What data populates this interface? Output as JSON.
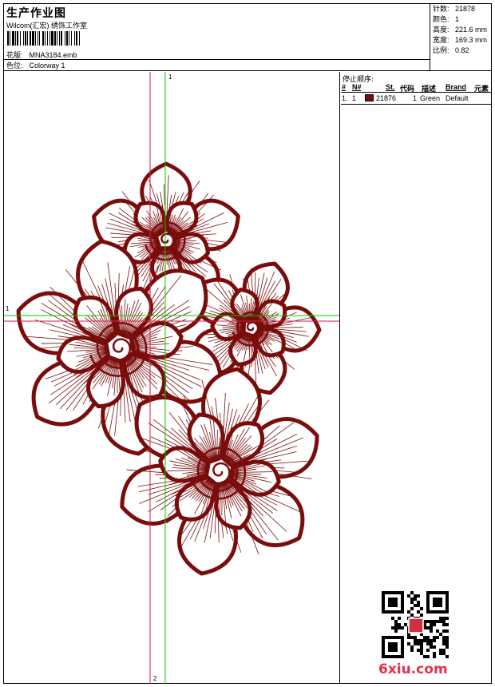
{
  "header": {
    "title": "生产作业图",
    "subtitle": "Wilcom(汇宏) 绣饰工作室",
    "pattern_label": "花版:",
    "pattern_value": "MNA3184.emb",
    "colorway_label": "色位:",
    "colorway_value": "Colorway 1"
  },
  "stats": [
    {
      "label": "针数:",
      "value": "21878"
    },
    {
      "label": "颜色:",
      "value": "1"
    },
    {
      "label": "高度:",
      "value": "221.6 mm"
    },
    {
      "label": "宽度:",
      "value": "169.3 mm"
    },
    {
      "label": "比例:",
      "value": "0.82"
    }
  ],
  "stop_sequence": {
    "title": "停止顺序:",
    "columns": [
      "#",
      "N#",
      "St.",
      "代码",
      "描述",
      "Brand",
      "元素"
    ],
    "rows": [
      {
        "index": "1.",
        "num": "1",
        "stitches": "21876",
        "code": "1",
        "desc": "Green",
        "brand": "Default",
        "color": "#7a0c0c"
      }
    ]
  },
  "guides": {
    "vertical_label_top": "1",
    "vertical_label_bottom": "2",
    "horizontal_label_left": "1"
  },
  "colors": {
    "thread": "#7a0c0c",
    "guide_green": "#00cc00",
    "guide_red": "#cc2244"
  },
  "watermark": "6xiu.com"
}
